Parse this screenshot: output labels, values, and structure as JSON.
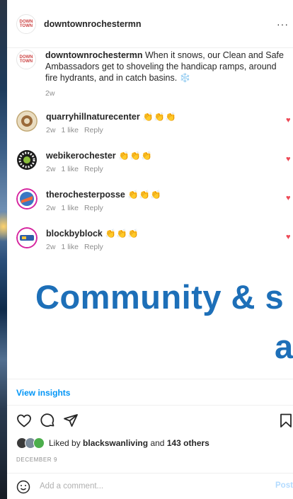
{
  "header": {
    "logo_text": "DOWN TOWN",
    "username": "downtownrochestermn",
    "more": "···"
  },
  "caption": {
    "username": "downtownrochestermn",
    "text": "When it snows, our Clean and Safe Ambassadors get to shoveling the handicap ramps, around fire hydrants, and in catch basins. ❄️",
    "time": "2w"
  },
  "comments": [
    {
      "username": "quarryhillnaturecenter",
      "text": "👏👏👏",
      "time": "2w",
      "likes": "1 like",
      "reply": "Reply"
    },
    {
      "username": "webikerochester",
      "text": "👏👏👏",
      "time": "2w",
      "likes": "1 like",
      "reply": "Reply"
    },
    {
      "username": "therochesterposse",
      "text": "👏👏👏",
      "time": "2w",
      "likes": "1 like",
      "reply": "Reply"
    },
    {
      "username": "blockbyblock",
      "text": "👏👏👏",
      "time": "2w",
      "likes": "1 like",
      "reply": "Reply"
    }
  ],
  "background_text": {
    "line1": "Community & s",
    "line2": "a"
  },
  "insights": "View insights",
  "likes": {
    "prefix": "Liked by",
    "user": "blackswanliving",
    "and": "and",
    "others": "143 others"
  },
  "date": "DECEMBER 9",
  "add_comment": {
    "placeholder": "Add a comment...",
    "post": "Post"
  },
  "colors": {
    "accent": "#0095f6",
    "heart": "#ed4956",
    "overlay_blue": "#1d6fb8"
  }
}
